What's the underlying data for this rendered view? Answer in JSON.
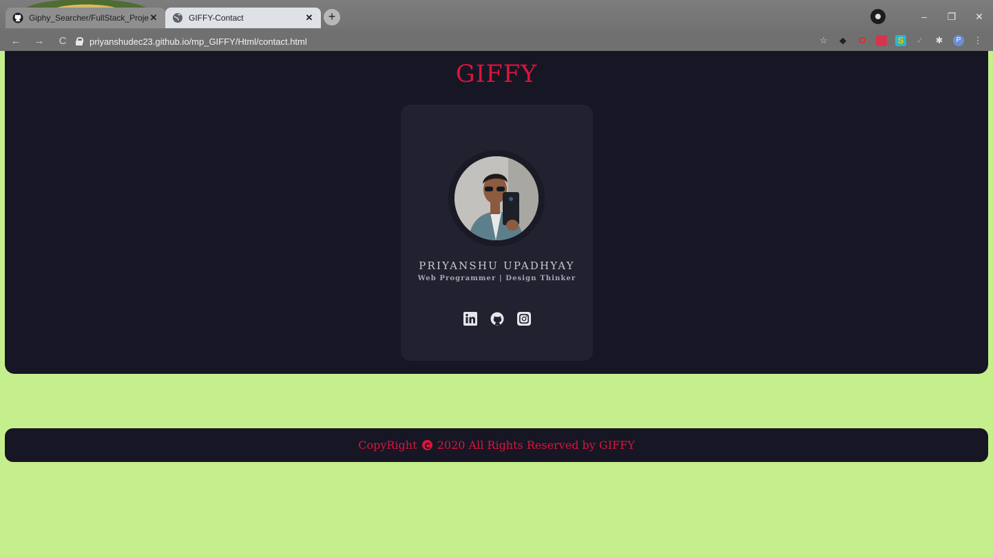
{
  "browser": {
    "tabs": [
      {
        "title": "Giphy_Searcher/FullStack_Projec",
        "active": false,
        "icon": "github-icon"
      },
      {
        "title": "GIFFY-Contact",
        "active": true,
        "icon": "globe-icon"
      }
    ],
    "new_tab_label": "+",
    "url": "priyanshudec23.github.io/mp_GIFFY/Html/contact.html",
    "window_controls": {
      "minimize": "–",
      "maximize": "❐",
      "close": "✕"
    },
    "nav": {
      "back": "←",
      "forward": "→",
      "reload": "C"
    },
    "extensions": [
      "star-icon",
      "ext-shield-icon",
      "ext-opera-icon",
      "ext-mask-icon",
      "ext-s-icon",
      "ext-check-icon",
      "puzzle-icon",
      "profile-icon",
      "menu-icon"
    ],
    "profile_initial": "P"
  },
  "header": {
    "brand": "GIFFY"
  },
  "profile": {
    "name": "PRIYANSHU UPADHYAY",
    "role": "Web Programmer | Design Thinker",
    "socials": [
      "linkedin-icon",
      "github-icon",
      "instagram-icon"
    ]
  },
  "footer": {
    "text_before": "CopyRight",
    "text_after": "2020 All Rights Reserved by GIFFY"
  },
  "colors": {
    "brand": "#dc143c",
    "panel": "#171624",
    "card": "#222130",
    "page_bg": "#c5ef8c"
  }
}
